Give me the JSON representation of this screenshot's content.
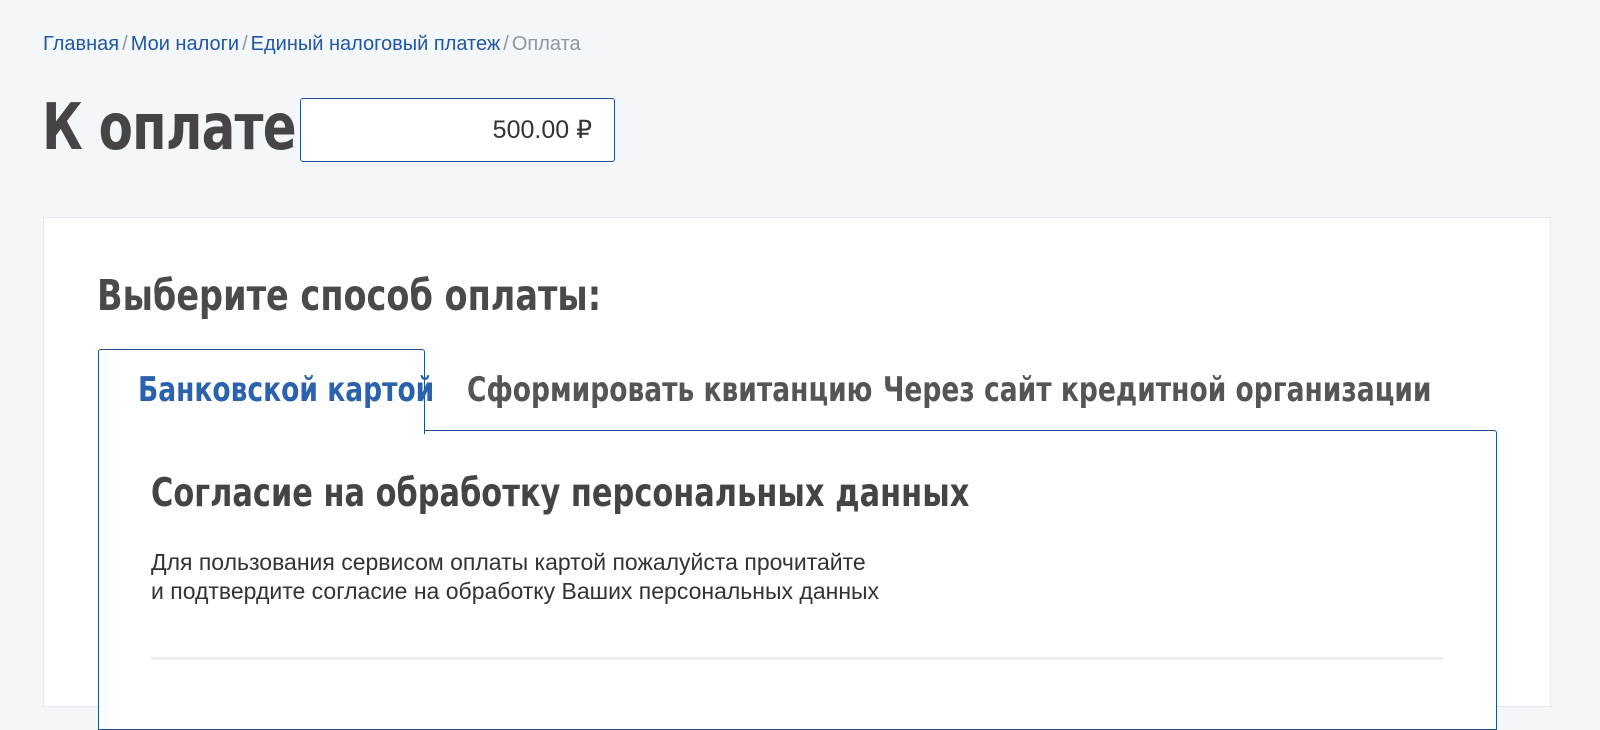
{
  "breadcrumb": {
    "items": [
      "Главная",
      "Мои налоги",
      "Единый налоговый платеж"
    ],
    "current": "Оплата",
    "separator": "/"
  },
  "payment": {
    "title": "К оплате:",
    "amount": "500.00 ₽"
  },
  "method": {
    "title": "Выберите способ оплаты:",
    "tabs": [
      {
        "label": "Банковской картой",
        "active": true
      },
      {
        "label": "Сформировать квитанцию",
        "active": false
      },
      {
        "label": "Через сайт кредитной организации",
        "active": false
      }
    ]
  },
  "consent": {
    "title": "Согласие на обработку персональных данных",
    "line1": "Для пользования сервисом оплаты картой пожалуйста прочитайте",
    "line2": "и подтвердите согласие на обработку Ваших персональных данных"
  },
  "colors": {
    "accent": "#1f57a6",
    "border": "#1f4f94",
    "background": "#f4f7fa"
  }
}
